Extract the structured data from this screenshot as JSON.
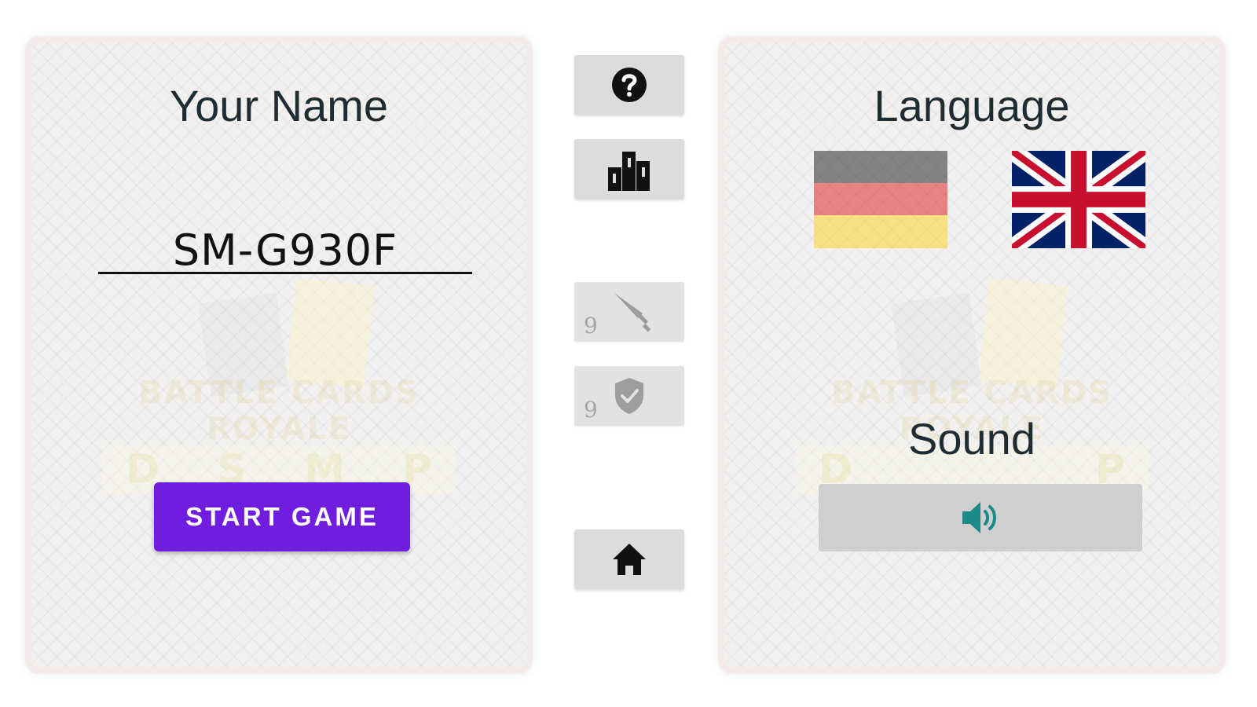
{
  "left_panel": {
    "title": "Your Name",
    "name_value": "SM-G930F",
    "start_label": "START GAME",
    "watermark_title": "BATTLE CARDS ROYALE",
    "watermark_letters": [
      "D",
      "S",
      "M",
      "P"
    ]
  },
  "middle_toolbar": {
    "help_icon": "question-circle",
    "leaderboard_icon": "podium",
    "attack_count": "9",
    "attack_icon": "sword",
    "defense_count": "9",
    "defense_icon": "shield-check",
    "home_icon": "home"
  },
  "right_panel": {
    "language_title": "Language",
    "languages": [
      {
        "code": "de",
        "selected": false
      },
      {
        "code": "en-GB",
        "selected": true
      }
    ],
    "sound_title": "Sound",
    "sound_icon": "volume-up",
    "sound_icon_color": "#1a8a8a",
    "watermark_title": "BATTLE CARDS ROYALE",
    "watermark_letters": [
      "D",
      "P"
    ]
  },
  "colors": {
    "start_button": "#6f1ee0",
    "card_border": "#f4ecea"
  }
}
